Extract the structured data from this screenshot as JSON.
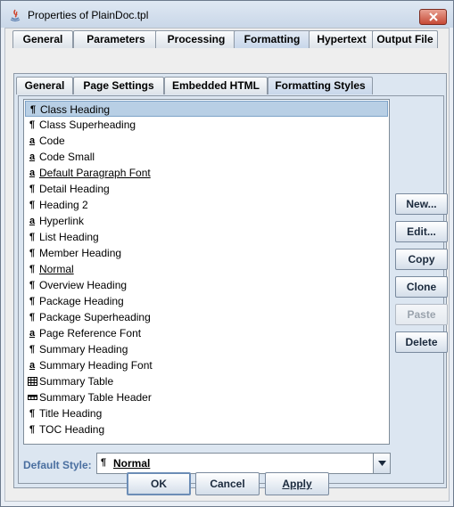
{
  "window": {
    "title": "Properties of PlainDoc.tpl"
  },
  "tabs_top": [
    "General",
    "Parameters",
    "Processing",
    "Formatting",
    "Hypertext",
    "Output File"
  ],
  "tabs_top_selected": "Formatting",
  "tabs_sub": [
    "General",
    "Page Settings",
    "Embedded HTML",
    "Formatting Styles"
  ],
  "tabs_sub_selected": "Formatting Styles",
  "styles": [
    {
      "icon": "paragraph",
      "glyph": "¶",
      "label": "Class Heading"
    },
    {
      "icon": "paragraph",
      "glyph": "¶",
      "label": "Class Superheading"
    },
    {
      "icon": "character",
      "glyph": "a",
      "label": "Code"
    },
    {
      "icon": "character",
      "glyph": "a",
      "label": "Code Small"
    },
    {
      "icon": "character",
      "glyph": "a",
      "label": "Default Paragraph Font"
    },
    {
      "icon": "paragraph",
      "glyph": "¶",
      "label": "Detail Heading"
    },
    {
      "icon": "paragraph",
      "glyph": "¶",
      "label": "Heading 2"
    },
    {
      "icon": "character",
      "glyph": "a",
      "label": "Hyperlink"
    },
    {
      "icon": "paragraph",
      "glyph": "¶",
      "label": "List Heading"
    },
    {
      "icon": "paragraph",
      "glyph": "¶",
      "label": "Member Heading"
    },
    {
      "icon": "paragraph",
      "glyph": "¶",
      "label": "Normal"
    },
    {
      "icon": "paragraph",
      "glyph": "¶",
      "label": "Overview Heading"
    },
    {
      "icon": "paragraph",
      "glyph": "¶",
      "label": "Package Heading"
    },
    {
      "icon": "paragraph",
      "glyph": "¶",
      "label": "Package Superheading"
    },
    {
      "icon": "character",
      "glyph": "a",
      "label": "Page Reference Font"
    },
    {
      "icon": "paragraph",
      "glyph": "¶",
      "label": "Summary Heading"
    },
    {
      "icon": "character",
      "glyph": "a",
      "label": "Summary Heading Font"
    },
    {
      "icon": "table",
      "glyph": "",
      "label": "Summary Table"
    },
    {
      "icon": "table-row",
      "glyph": "",
      "label": "Summary Table Header"
    },
    {
      "icon": "paragraph",
      "glyph": "¶",
      "label": "Title Heading"
    },
    {
      "icon": "paragraph",
      "glyph": "¶",
      "label": "TOC Heading"
    }
  ],
  "selected_style": "Class Heading",
  "underlined_styles": [
    "Default Paragraph Font",
    "Normal"
  ],
  "side_buttons": [
    {
      "label": "New...",
      "enabled": true
    },
    {
      "label": "Edit...",
      "enabled": true
    },
    {
      "label": "Copy",
      "enabled": true
    },
    {
      "label": "Clone",
      "enabled": true
    },
    {
      "label": "Paste",
      "enabled": false
    },
    {
      "label": "Delete",
      "enabled": true
    }
  ],
  "default_style": {
    "label": "Default Style:",
    "icon_glyph": "¶",
    "value": "Normal"
  },
  "bottom_buttons": {
    "ok": "OK",
    "cancel": "Cancel",
    "apply": "Apply"
  },
  "colors": {
    "selection": "#b8cfe5",
    "label_blue": "#4a6fa0",
    "close_red": "#c74a36"
  }
}
